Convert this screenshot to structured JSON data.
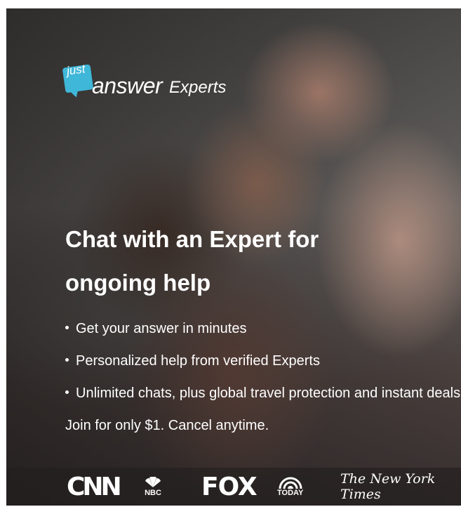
{
  "brand": {
    "just": "just",
    "answer": "answer",
    "experts": "Experts",
    "bubble_color": "#3fb7d8"
  },
  "hero": {
    "headline": "Chat with an Expert for ongoing help",
    "bullets": [
      "Get your answer in minutes",
      "Personalized help from verified Experts",
      "Unlimited chats, plus global travel protection and instant deals"
    ],
    "join_text": "Join for only $1. Cancel anytime."
  },
  "press": {
    "cnn": "CNN",
    "nbc": "NBC",
    "fox": "FOX",
    "today": "TODAY",
    "nyt": "The New York Times"
  }
}
